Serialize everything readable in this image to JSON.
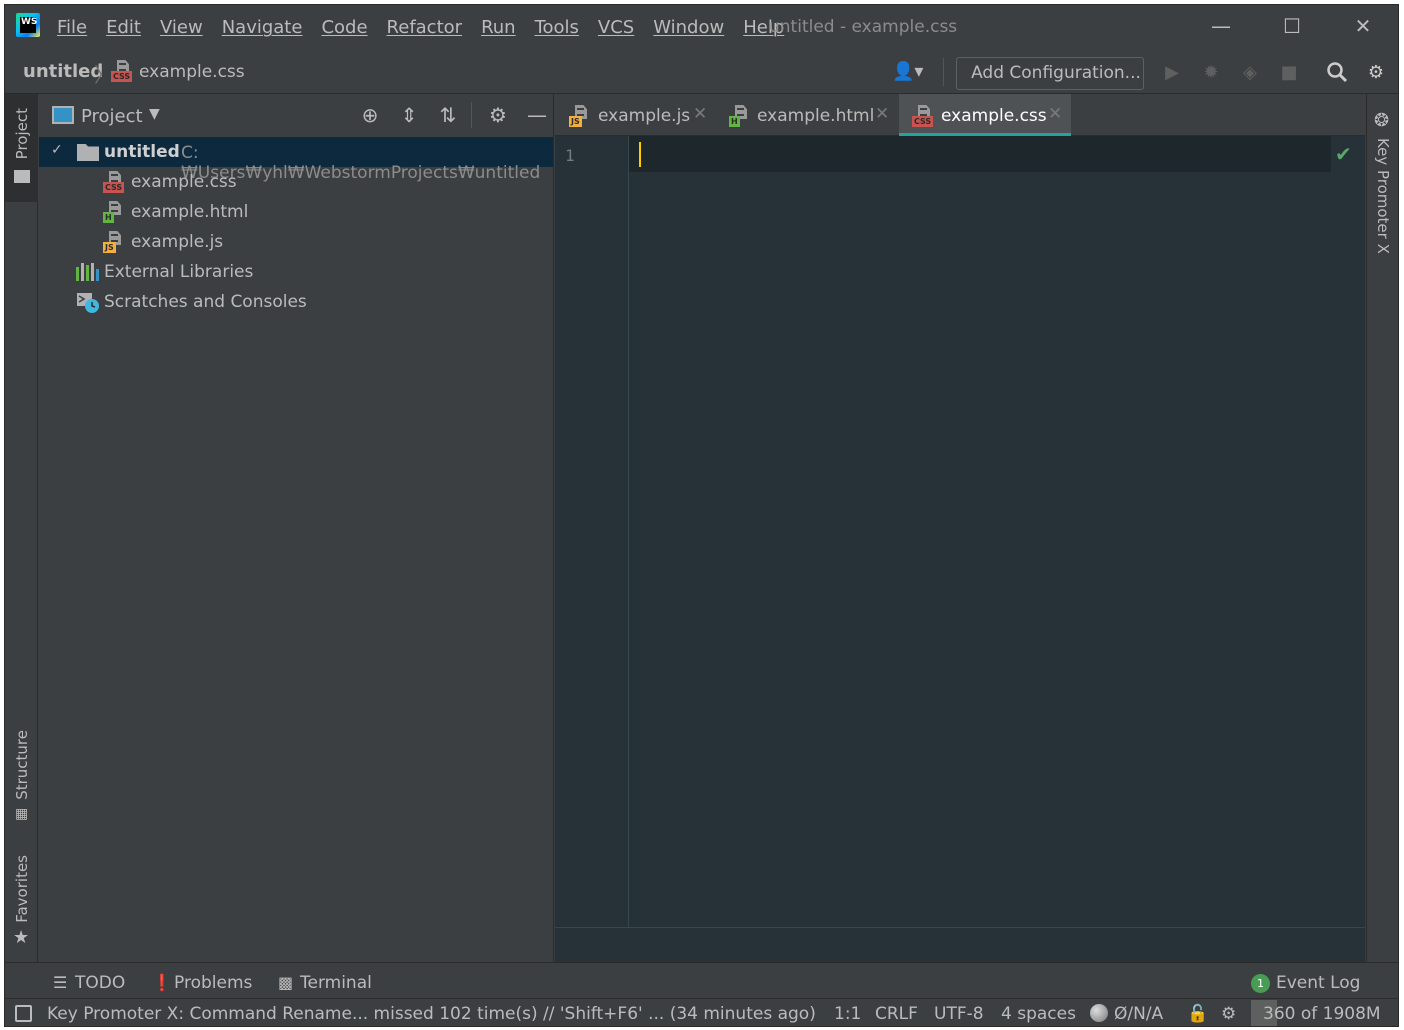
{
  "window": {
    "title": "untitled - example.css",
    "menu": [
      "File",
      "Edit",
      "View",
      "Navigate",
      "Code",
      "Refactor",
      "Run",
      "Tools",
      "VCS",
      "Window",
      "Help"
    ],
    "app_logo_text": "WS"
  },
  "navbar": {
    "project": "untitled",
    "file": "example.css",
    "add_configuration": "Add Configuration..."
  },
  "left_stripe": {
    "project_tab": "Project",
    "structure_tab": "Structure",
    "favorites_tab": "Favorites"
  },
  "project_panel": {
    "title": "Project",
    "root": {
      "name": "untitled",
      "path": "C:₩Users₩yhl₩WebstormProjects₩untitled"
    },
    "files": [
      {
        "name": "example.css",
        "badge": "CSS"
      },
      {
        "name": "example.html",
        "badge": "H"
      },
      {
        "name": "example.js",
        "badge": "JS"
      }
    ],
    "external_libraries": "External Libraries",
    "scratches": "Scratches and Consoles"
  },
  "editor": {
    "tabs": [
      {
        "label": "example.js",
        "badge": "JS"
      },
      {
        "label": "example.html",
        "badge": "H"
      },
      {
        "label": "example.css",
        "badge": "CSS",
        "active": true
      }
    ],
    "line_numbers": [
      "1"
    ]
  },
  "right_stripe": {
    "key_promoter": "Key Promoter X"
  },
  "bottom_tools": {
    "todo": "TODO",
    "problems": "Problems",
    "terminal": "Terminal",
    "event_log": "Event Log",
    "event_count": "1"
  },
  "status_bar": {
    "message": "Key Promoter X: Command Rename... missed 102 time(s) // 'Shift+F6' ... (34 minutes ago)",
    "position": "1:1",
    "line_separator": "CRLF",
    "encoding": "UTF-8",
    "indent": "4 spaces",
    "context": "Ø/N/A",
    "memory": "360 of 1908M",
    "memory_fraction": 0.19
  },
  "colors": {
    "accent_tab": "#26a39b",
    "selection": "#0d293e",
    "caret": "#ffcc00",
    "ok_check": "#59a869"
  }
}
